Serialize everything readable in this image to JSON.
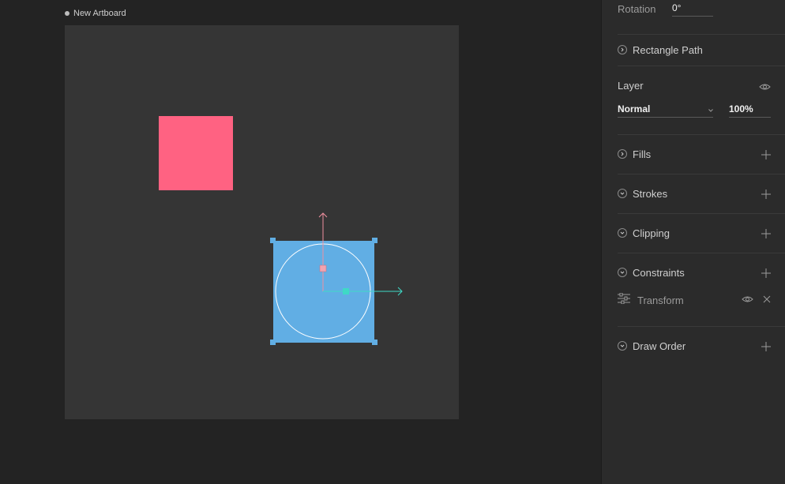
{
  "artboard": {
    "title": "New Artboard"
  },
  "inspector": {
    "rotation": {
      "label": "Rotation",
      "value": "0°"
    },
    "rectangle_path": {
      "label": "Rectangle Path"
    },
    "layer": {
      "label": "Layer",
      "blend_mode": "Normal",
      "opacity": "100%"
    },
    "fills": {
      "label": "Fills"
    },
    "strokes": {
      "label": "Strokes"
    },
    "clipping": {
      "label": "Clipping"
    },
    "constraints": {
      "label": "Constraints",
      "items": [
        {
          "label": "Transform"
        }
      ]
    },
    "draw_order": {
      "label": "Draw Order"
    }
  },
  "colors": {
    "pink_shape": "#ff6282",
    "blue_shape": "#61aee4",
    "y_axis": "#f0909f",
    "x_axis": "#3fd9c6"
  }
}
